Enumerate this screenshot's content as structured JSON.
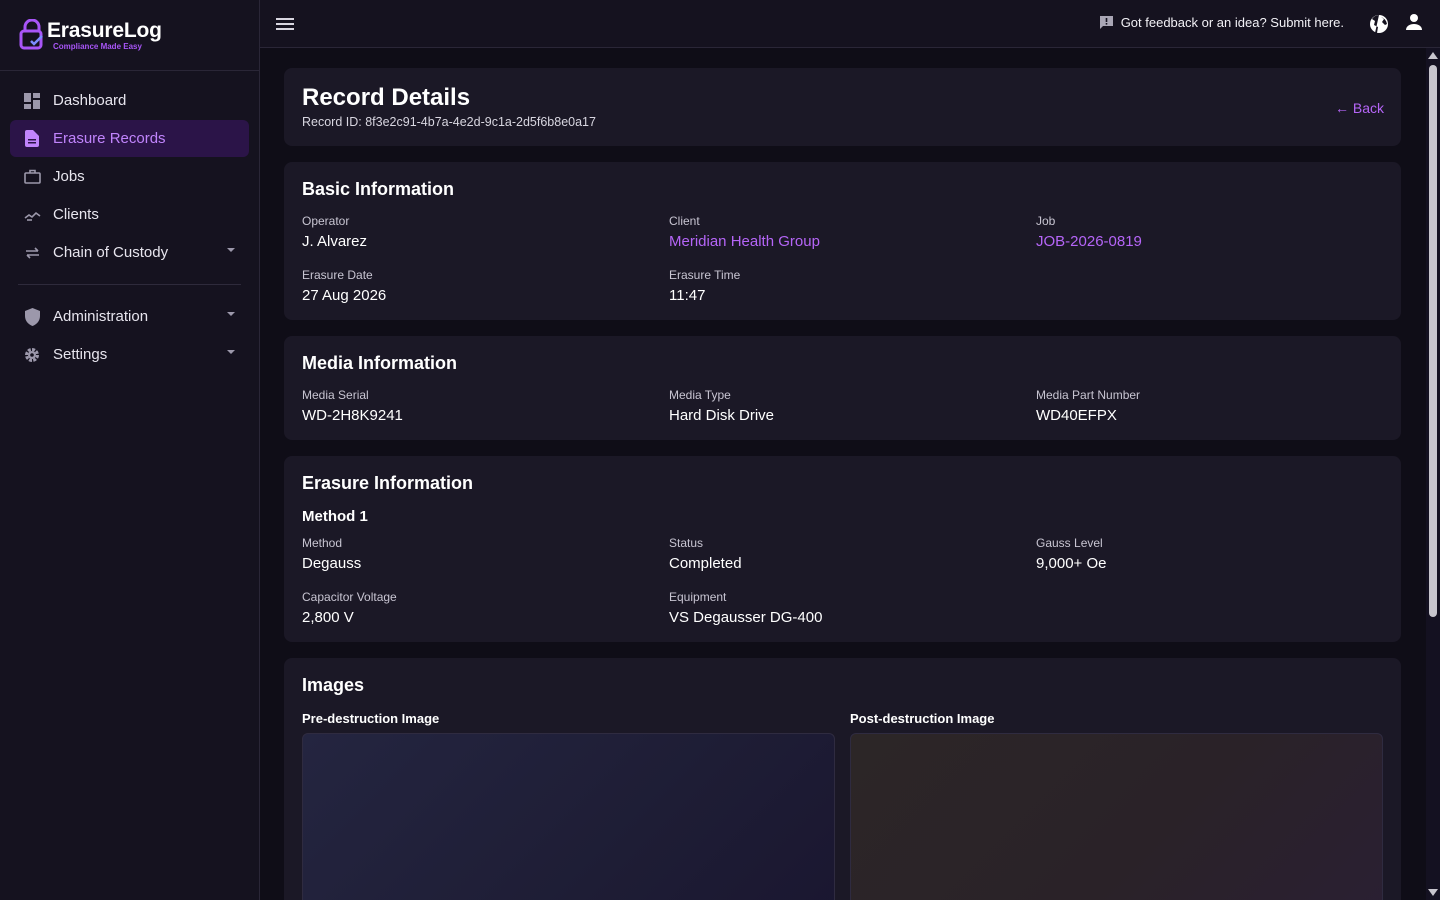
{
  "brand": {
    "name": "ErasureLog",
    "tagline": "Compliance Made Easy",
    "accent": "#a855f7"
  },
  "sidebar": {
    "items": [
      {
        "label": "Dashboard",
        "icon": "dashboard-icon",
        "active": false
      },
      {
        "label": "Erasure Records",
        "icon": "document-icon",
        "active": true
      },
      {
        "label": "Jobs",
        "icon": "briefcase-icon",
        "active": false
      },
      {
        "label": "Clients",
        "icon": "handshake-icon",
        "active": false
      },
      {
        "label": "Chain of Custody",
        "icon": "swap-icon",
        "active": false,
        "expandable": true
      }
    ],
    "admin_items": [
      {
        "label": "Administration",
        "icon": "shield-icon",
        "expandable": true
      },
      {
        "label": "Settings",
        "icon": "gear-icon",
        "expandable": true
      }
    ]
  },
  "topbar": {
    "feedback_text": "Got feedback or an idea? Submit here.",
    "feedback_icon": "feedback-icon",
    "language_icon": "globe-icon",
    "account_icon": "user-icon"
  },
  "header": {
    "title": "Record Details",
    "record_id": "Record ID: 8f3e2c91-4b7a-4e2d-9c1a-2d5f6b8e0a17",
    "back_label": "← Back"
  },
  "basic_info": {
    "heading": "Basic Information",
    "operator_label": "Operator",
    "operator": "J. Alvarez",
    "client_label": "Client",
    "client": "Meridian Health Group",
    "job_label": "Job",
    "job": "JOB-2026-0819",
    "date_label": "Erasure Date",
    "date": "27 Aug 2026",
    "time_label": "Erasure Time",
    "time": "11:47"
  },
  "media_info": {
    "heading": "Media Information",
    "serial_label": "Media Serial",
    "serial": "WD-2H8K9241",
    "type_label": "Media Type",
    "type": "Hard Disk Drive",
    "part_label": "Media Part Number",
    "part": "WD40EFPX"
  },
  "erasure_info": {
    "heading": "Erasure Information",
    "method_heading": "Method 1",
    "method_label": "Method",
    "method": "Degauss",
    "status_label": "Status",
    "status": "Completed",
    "gauss_label": "Gauss Level",
    "gauss": "9,000+ Oe",
    "voltage_label": "Capacitor Voltage",
    "voltage": "2,800 V",
    "equipment_label": "Equipment",
    "equipment": "VS Degausser DG-400"
  },
  "images": {
    "heading": "Images",
    "pre_label": "Pre-destruction Image",
    "post_label": "Post-destruction Image"
  }
}
